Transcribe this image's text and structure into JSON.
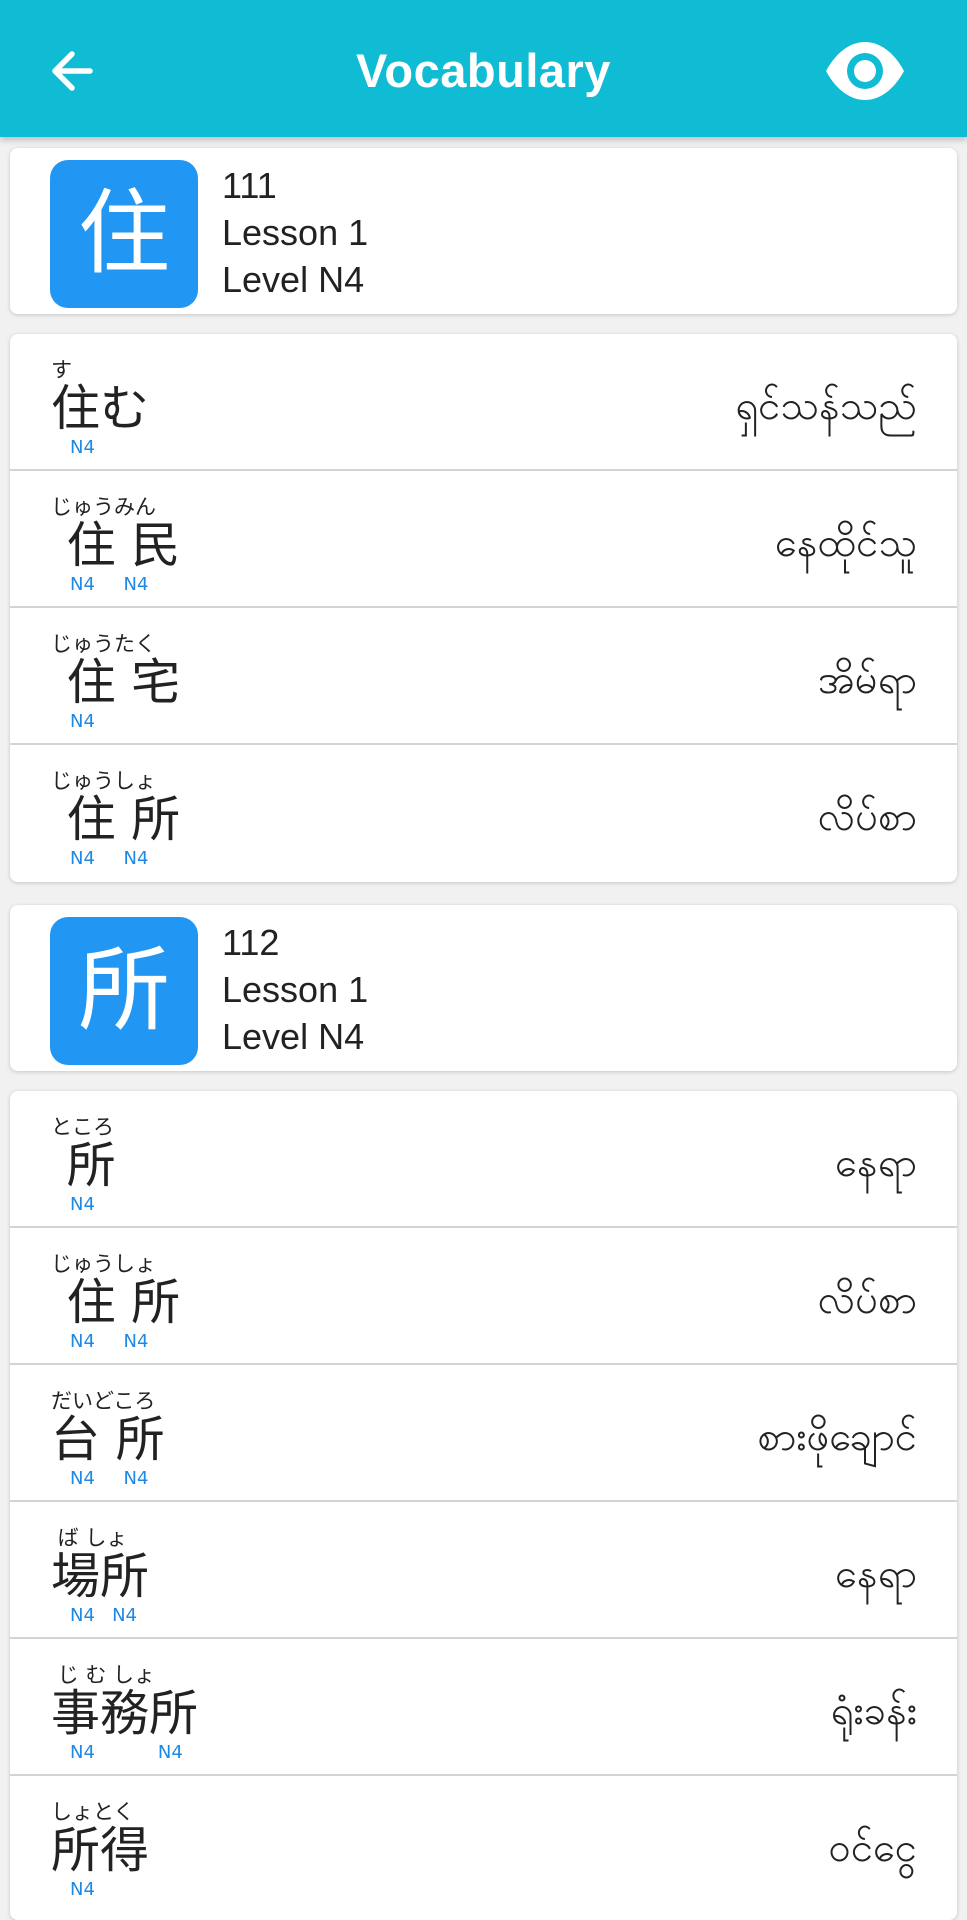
{
  "header": {
    "title": "Vocabulary",
    "back_icon": "arrow-left-icon",
    "visibility_icon": "eye-icon",
    "background_color": "#10bcd4"
  },
  "kanji_groups": [
    {
      "kanji": "住",
      "number": "111",
      "lesson": "Lesson 1",
      "level": "Level N4",
      "tile_color": "#2196f3",
      "words": [
        {
          "ruby": "す",
          "kanji": "住む",
          "levels": "N4",
          "meaning": "ရှင်သန်သည်"
        },
        {
          "ruby": "じゅうみん",
          "kanji": " 住 民",
          "levels": "N4     N4",
          "meaning": "နေထိုင်သူ"
        },
        {
          "ruby": "じゅうたく",
          "kanji": " 住 宅",
          "levels": "N4",
          "meaning": "အိမ်ရာ"
        },
        {
          "ruby": "じゅうしょ",
          "kanji": " 住 所",
          "levels": "N4     N4",
          "meaning": "လိပ်စာ"
        }
      ]
    },
    {
      "kanji": "所",
      "number": "112",
      "lesson": "Lesson 1",
      "level": "Level N4",
      "tile_color": "#2196f3",
      "words": [
        {
          "ruby": "ところ",
          "kanji": " 所",
          "levels": "N4",
          "meaning": "နေရာ"
        },
        {
          "ruby": "じゅうしょ",
          "kanji": " 住 所",
          "levels": "N4     N4",
          "meaning": "လိပ်စာ"
        },
        {
          "ruby": "だいどころ",
          "kanji": "台 所",
          "levels": "N4     N4",
          "meaning": "စားဖိုချောင်"
        },
        {
          "ruby": " ば しょ",
          "kanji": "場所",
          "levels": "N4   N4",
          "meaning": "နေရာ"
        },
        {
          "ruby": " じ む しょ",
          "kanji": "事務所",
          "levels": "N4           N4",
          "meaning": "ရုံးခန်း"
        },
        {
          "ruby": "しょとく",
          "kanji": "所得",
          "levels": "N4",
          "meaning": "ဝင်ငွေ"
        }
      ]
    }
  ]
}
